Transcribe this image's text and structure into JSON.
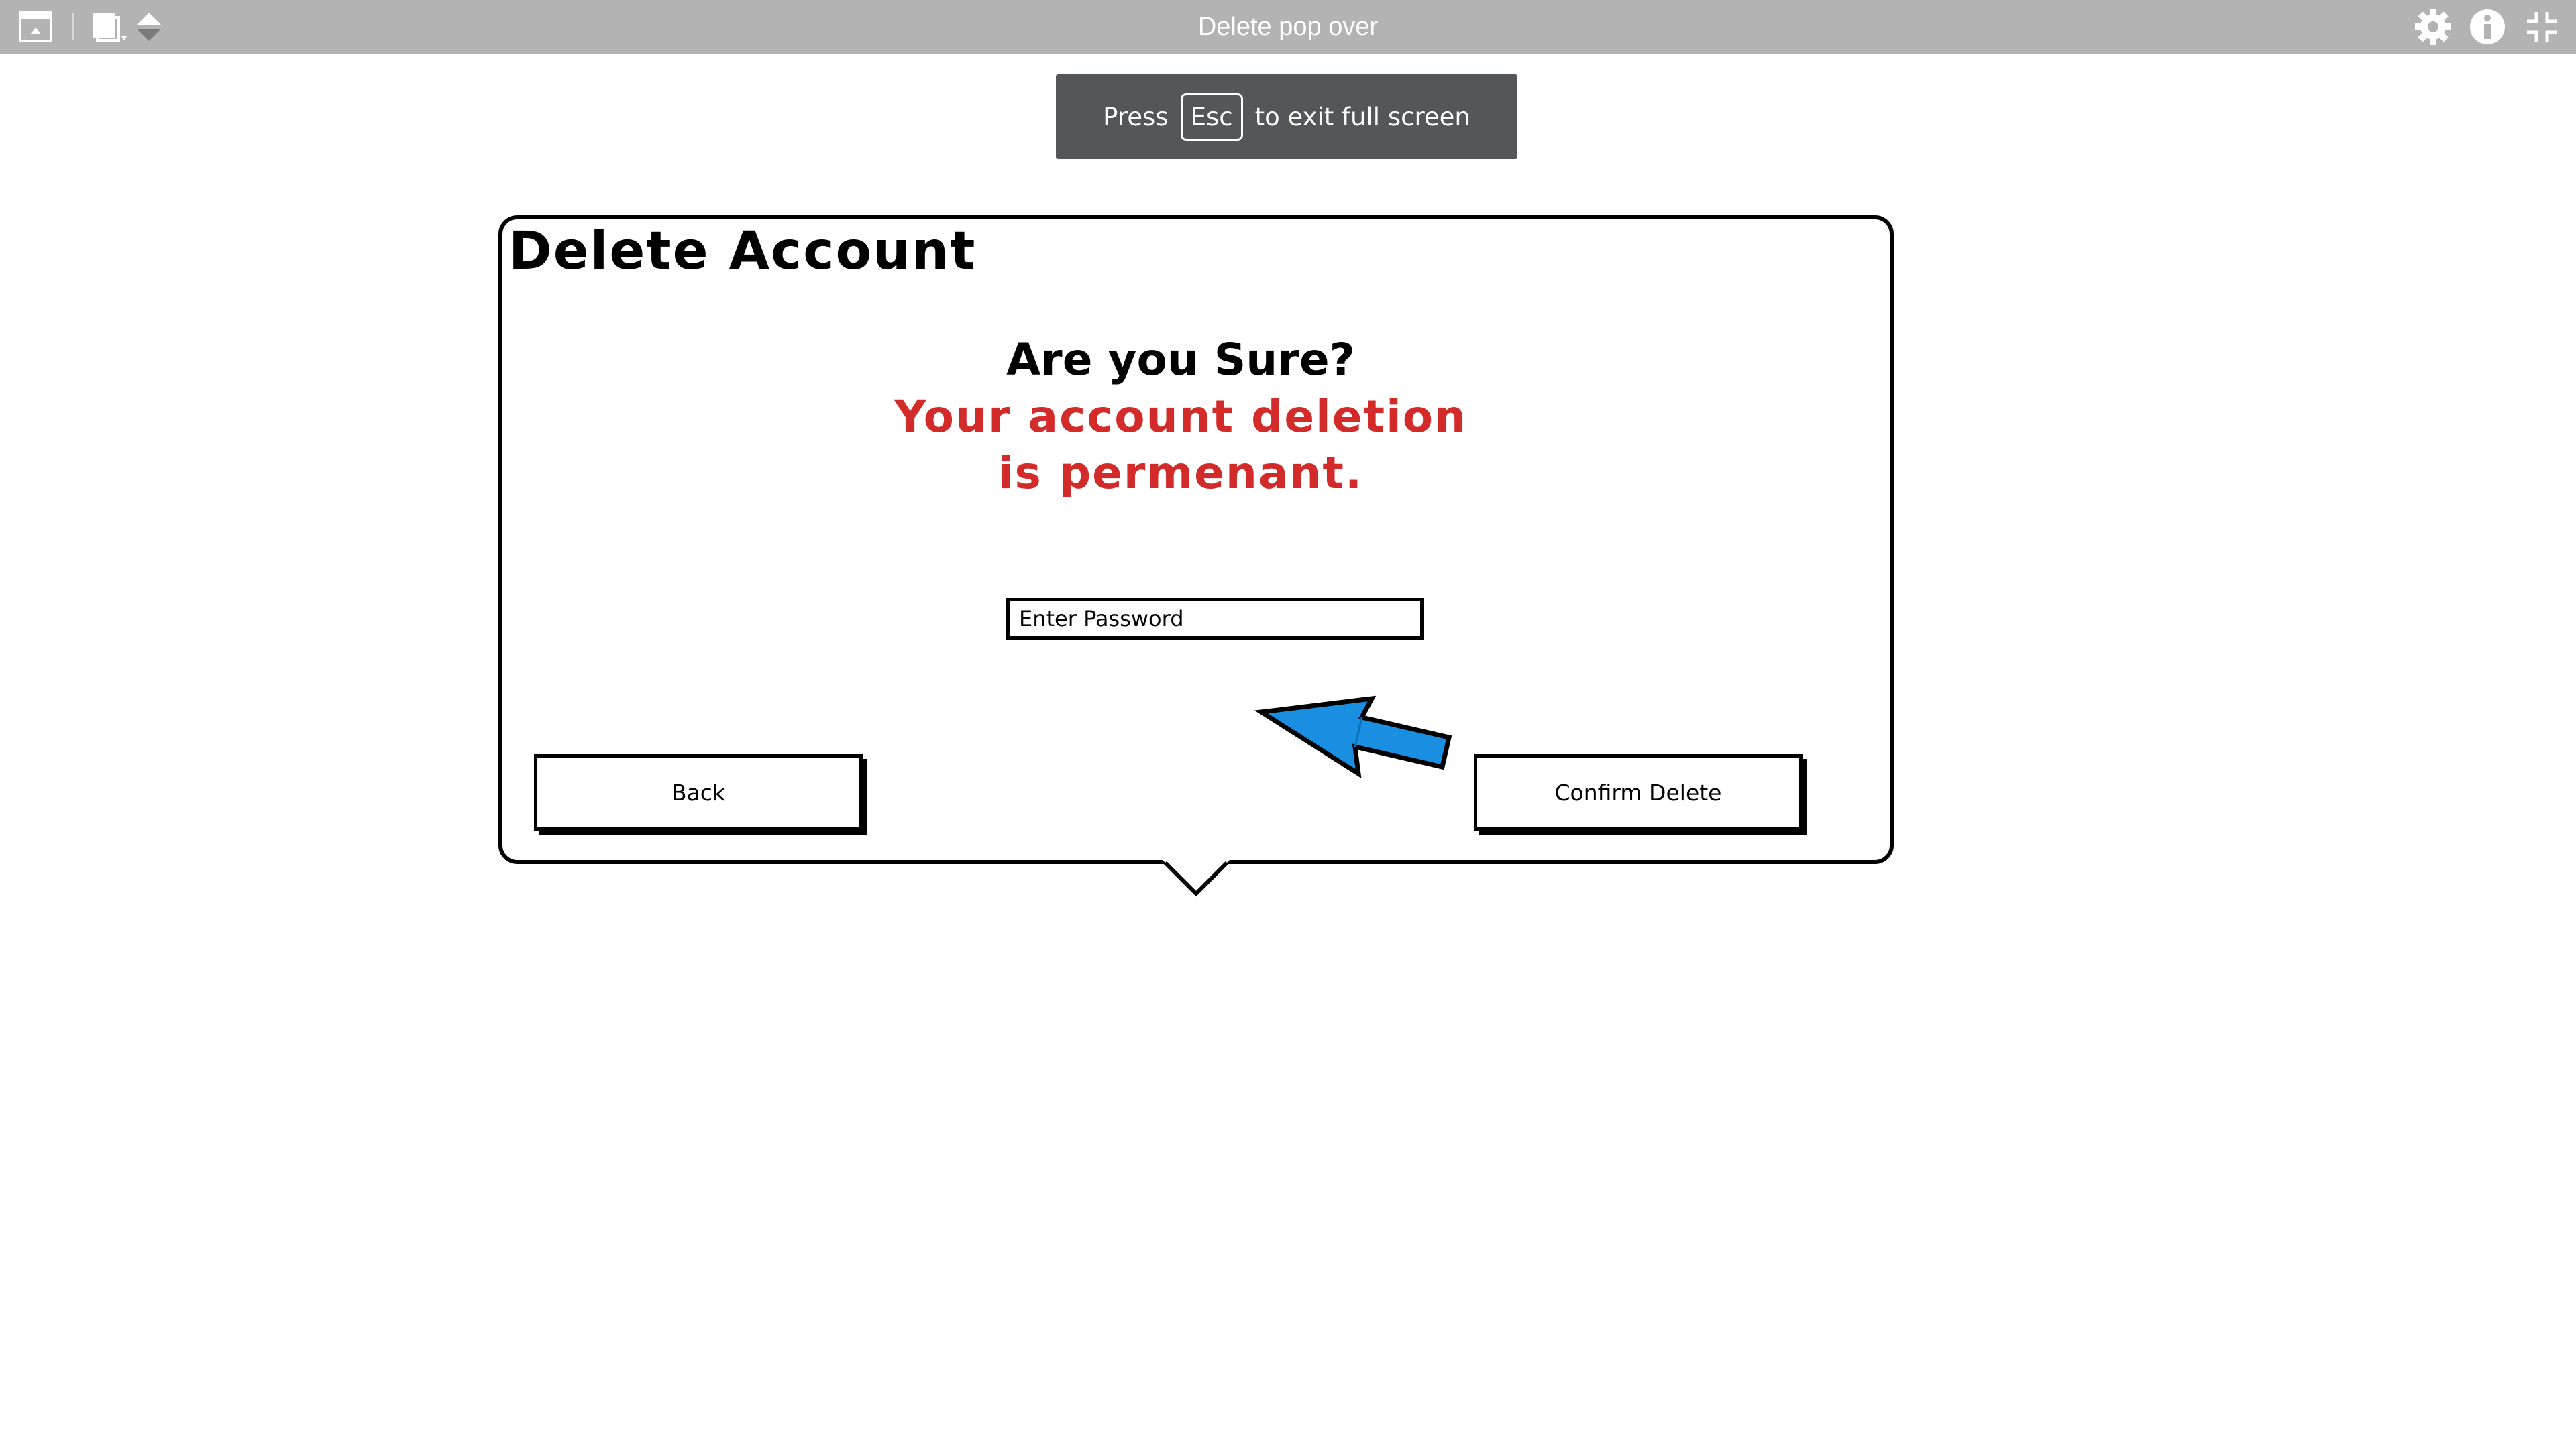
{
  "window": {
    "title": "Delete pop over"
  },
  "toolbar": {
    "icons": [
      "window-icon",
      "pages-icon",
      "sort-arrows-icon",
      "gear-icon",
      "info-icon",
      "exit-fullscreen-icon"
    ]
  },
  "toast": {
    "press": "Press",
    "key": "Esc",
    "suffix": "to exit full screen"
  },
  "popover": {
    "title": "Delete Account",
    "question": "Are you Sure?",
    "warning": "Your account deletion is permenant.",
    "password_placeholder": "Enter Password",
    "back_label": "Back",
    "confirm_label": "Confirm Delete",
    "arrow_color": "#1a8ee0",
    "warning_color": "#d32a2a"
  }
}
